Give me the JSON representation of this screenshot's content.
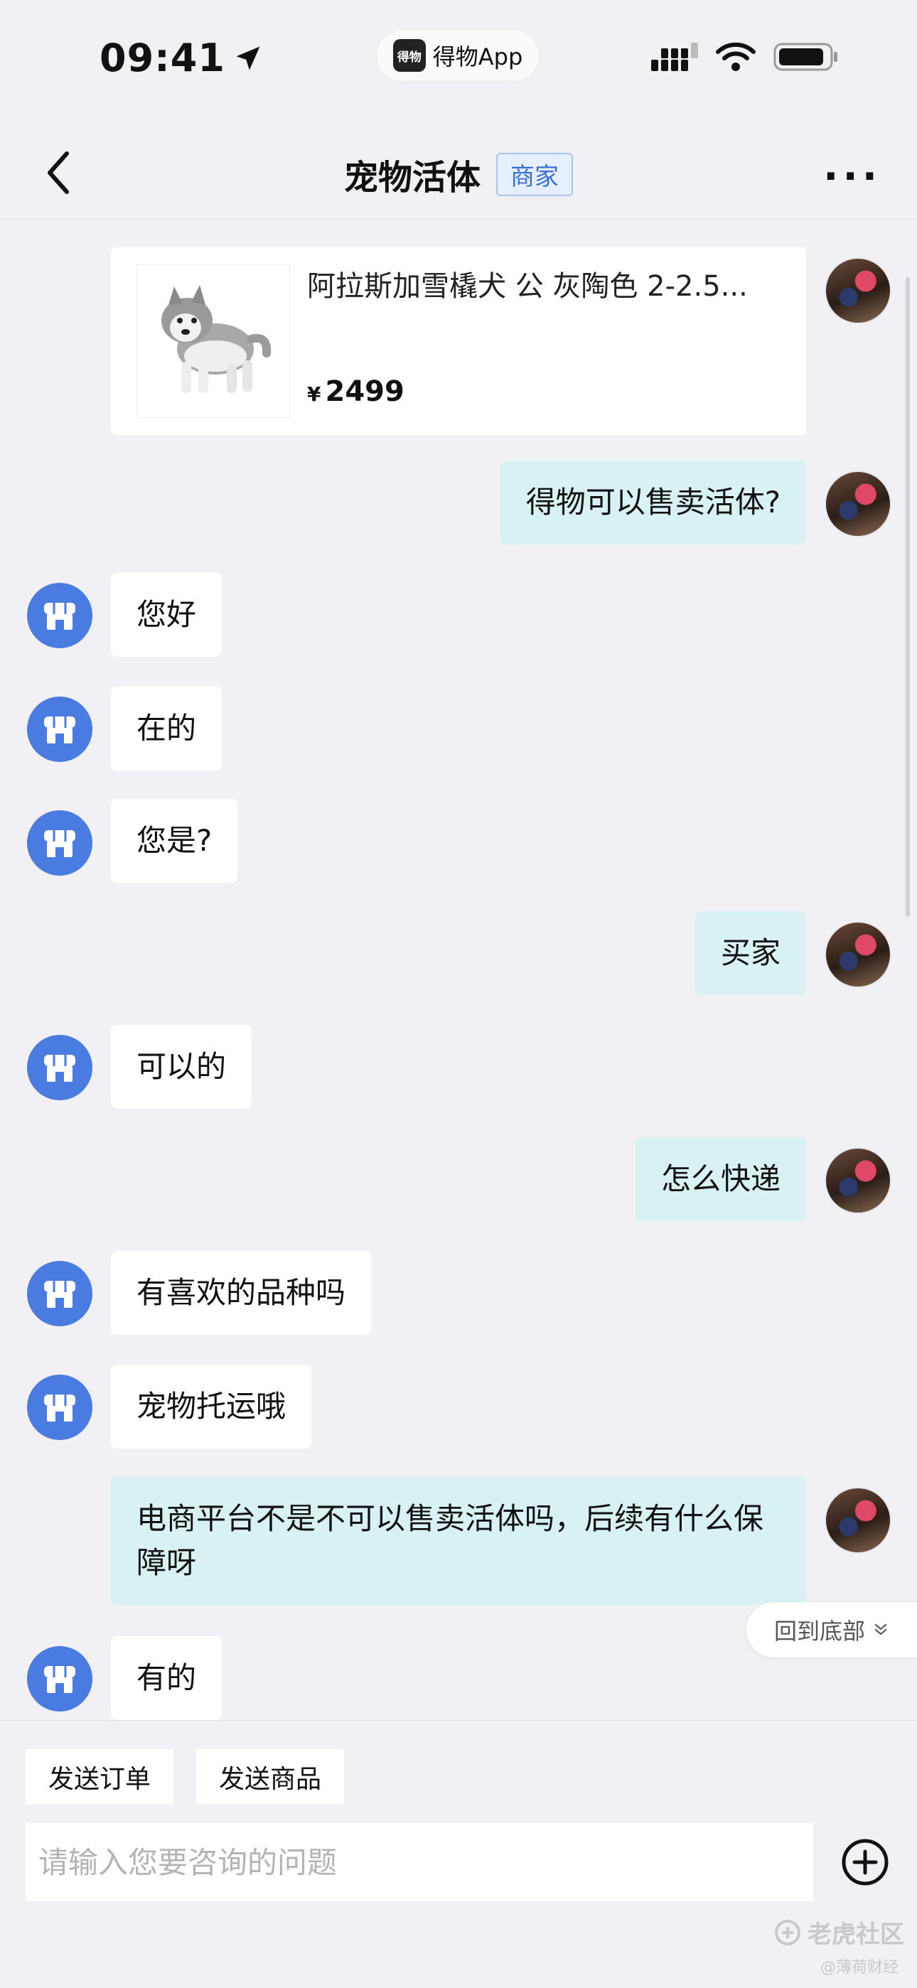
{
  "status_bar": {
    "time": "09:41",
    "app_pill": "得物App",
    "app_logo": "得物"
  },
  "nav": {
    "title": "宠物活体",
    "badge": "商家"
  },
  "product": {
    "title": "阿拉斯加雪橇犬 公 灰陶色 2-2.5...",
    "currency": "¥",
    "price": "2499"
  },
  "messages": [
    {
      "side": "right",
      "text": "得物可以售卖活体?"
    },
    {
      "side": "left",
      "text": "您好"
    },
    {
      "side": "left",
      "text": "在的"
    },
    {
      "side": "left",
      "text": "您是?"
    },
    {
      "side": "right",
      "text": "买家"
    },
    {
      "side": "left",
      "text": "可以的"
    },
    {
      "side": "right",
      "text": "怎么快递"
    },
    {
      "side": "left",
      "text": "有喜欢的品种吗"
    },
    {
      "side": "left",
      "text": "宠物托运哦"
    },
    {
      "side": "right",
      "text": "电商平台不是不可以售卖活体吗，后续有什么保障呀"
    },
    {
      "side": "left",
      "text": "有的"
    }
  ],
  "back_to_bottom": "回到底部",
  "quick_actions": {
    "send_order": "发送订单",
    "send_product": "发送商品"
  },
  "input": {
    "placeholder": "请输入您要咨询的问题"
  },
  "watermark": {
    "main": "老虎社区",
    "sub": "@薄荷财经"
  },
  "colors": {
    "page_bg": "#f1f1f5",
    "bubble_self": "#d8f1f3",
    "bubble_other": "#ffffff",
    "shop_avatar": "#4a7be0",
    "badge_text": "#3a6fd8"
  }
}
